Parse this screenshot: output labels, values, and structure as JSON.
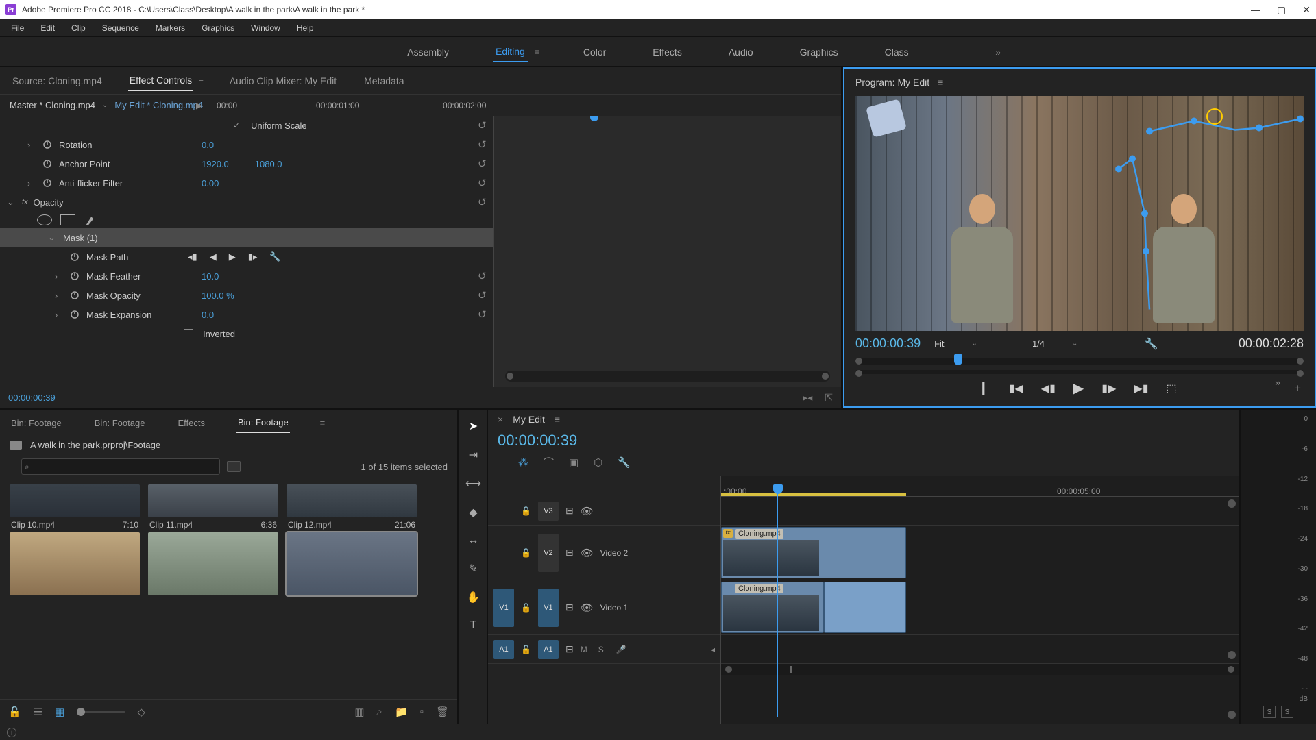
{
  "title_bar": {
    "app_icon_text": "Pr",
    "title": "Adobe Premiere Pro CC 2018 - C:\\Users\\Class\\Desktop\\A walk in the park\\A walk in the park *"
  },
  "menu": {
    "file": "File",
    "edit": "Edit",
    "clip": "Clip",
    "sequence": "Sequence",
    "markers": "Markers",
    "graphics": "Graphics",
    "window": "Window",
    "help": "Help"
  },
  "workspaces": {
    "assembly": "Assembly",
    "editing": "Editing",
    "color": "Color",
    "effects": "Effects",
    "audio": "Audio",
    "graphics": "Graphics",
    "class": "Class"
  },
  "source_panel": {
    "tabs": {
      "source": "Source: Cloning.mp4",
      "effect_controls": "Effect Controls",
      "audio_mixer": "Audio Clip Mixer: My Edit",
      "metadata": "Metadata"
    },
    "master": "Master * Cloning.mp4",
    "current": "My Edit * Cloning.mp4",
    "ruler": [
      "00:00",
      "00:00:01:00",
      "00:00:02:00"
    ],
    "props": {
      "uniform_scale": "Uniform Scale",
      "rotation": {
        "label": "Rotation",
        "value": "0.0"
      },
      "anchor": {
        "label": "Anchor Point",
        "x": "1920.0",
        "y": "1080.0"
      },
      "antiflicker": {
        "label": "Anti-flicker Filter",
        "value": "0.00"
      },
      "opacity": {
        "label": "Opacity"
      },
      "mask1": "Mask (1)",
      "mask_path": "Mask Path",
      "mask_feather": {
        "label": "Mask Feather",
        "value": "10.0"
      },
      "mask_opacity": {
        "label": "Mask Opacity",
        "value": "100.0 %"
      },
      "mask_expansion": {
        "label": "Mask Expansion",
        "value": "0.0"
      },
      "inverted": "Inverted"
    },
    "footer_tc": "00:00:00:39"
  },
  "program_monitor": {
    "title": "Program: My Edit",
    "timecode_left": "00:00:00:39",
    "fit": "Fit",
    "resolution": "1/4",
    "timecode_right": "00:00:02:28"
  },
  "project": {
    "tabs": {
      "bin1": "Bin: Footage",
      "bin2": "Bin: Footage",
      "effects": "Effects",
      "bin3": "Bin: Footage"
    },
    "breadcrumb": "A walk in the park.prproj\\Footage",
    "count": "1 of 15 items selected",
    "items": [
      {
        "name": "Clip 10.mp4",
        "dur": "7:10"
      },
      {
        "name": "Clip 11.mp4",
        "dur": "6:36"
      },
      {
        "name": "Clip 12.mp4",
        "dur": "21:06"
      }
    ]
  },
  "timeline": {
    "seq_name": "My Edit",
    "timecode": "00:00:00:39",
    "ruler": {
      "t0": ":00:00",
      "t1": "00:00:05:00"
    },
    "tracks": {
      "v3": "V3",
      "v2": "V2",
      "v2_name": "Video 2",
      "v1": "V1",
      "v1_name": "Video 1",
      "a1": "A1",
      "m": "M",
      "s": "S"
    },
    "clips": {
      "v2_clip": "Cloning.mp4",
      "v1_clip": "Cloning.mp4"
    }
  },
  "meters": {
    "scale": [
      "0",
      "-6",
      "-12",
      "-18",
      "-24",
      "-30",
      "-36",
      "-42",
      "-48",
      "- -"
    ],
    "db": "dB",
    "solo": "S"
  }
}
